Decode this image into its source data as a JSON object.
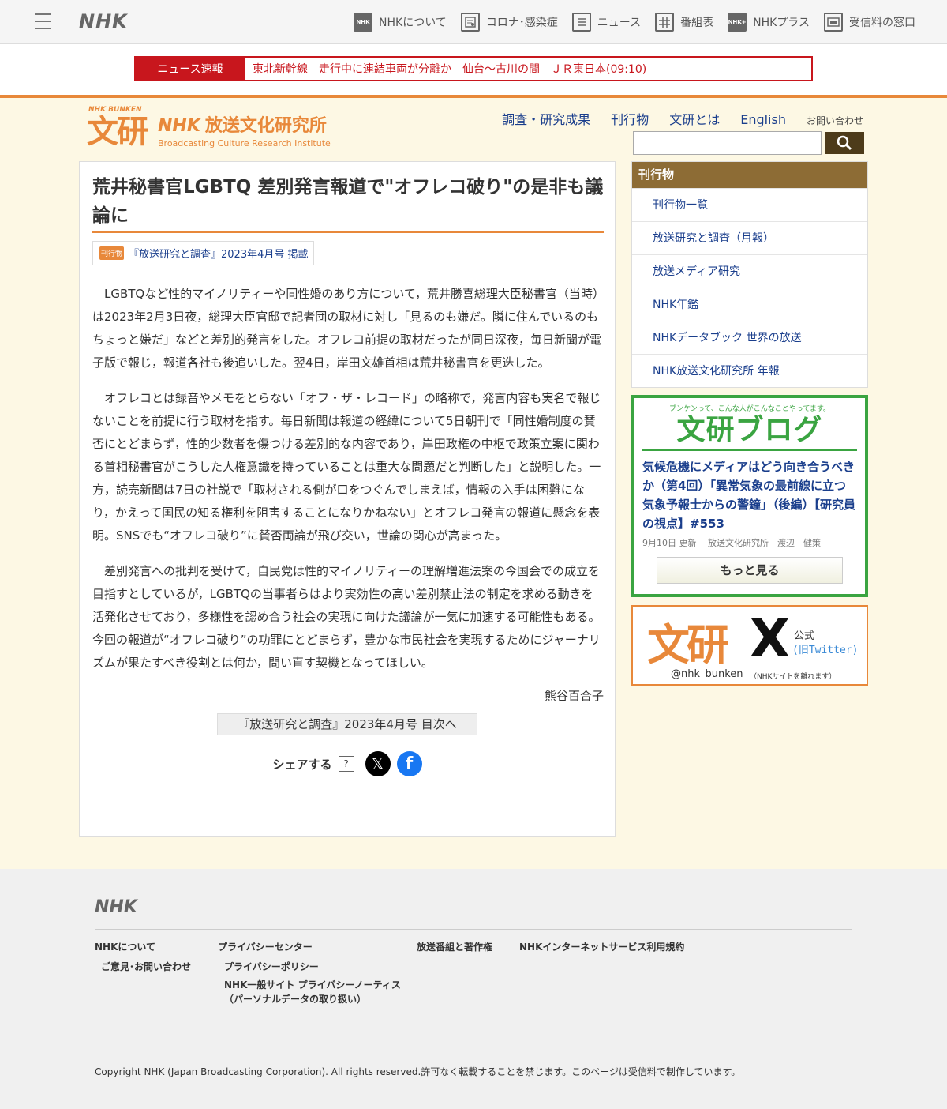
{
  "global_header": {
    "logo": "NHK",
    "nav": [
      {
        "icon": "nhk-icon",
        "icon_text": "NHK",
        "label": "NHKについて"
      },
      {
        "icon": "corona-icon",
        "icon_text": "",
        "label": "コロナ･感染症"
      },
      {
        "icon": "news-icon",
        "icon_text": "",
        "label": "ニュース"
      },
      {
        "icon": "program-guide-icon",
        "icon_text": "",
        "label": "番組表"
      },
      {
        "icon": "nhk-plus-icon",
        "icon_text": "NHK+",
        "label": "NHKプラス"
      },
      {
        "icon": "reception-fee-icon",
        "icon_text": "",
        "label": "受信料の窓口"
      }
    ]
  },
  "breaking_news": {
    "label": "ニュース速報",
    "text": "東北新幹線　走行中に連結車両が分離か　仙台～古川の間　ＪＲ東日本(09:10)"
  },
  "site_header": {
    "logo_small": "NHK BUNKEN",
    "logo_big": "文研",
    "institute_nhk": "NHK",
    "institute_jp": "放送文化研究所",
    "institute_en": "Broadcasting Culture Research Institute",
    "nav": [
      "調査・研究成果",
      "刊行物",
      "文研とは",
      "English",
      "お問い合わせ"
    ],
    "search_placeholder": ""
  },
  "article": {
    "title": "荒井秘書官LGBTQ 差別発言報道で\"オフレコ破り\"の是非も議論に",
    "pub_badge": "刊行物",
    "pub_text": "『放送研究と調査』2023年4月号 掲載",
    "paragraphs": [
      "LGBTQなど性的マイノリティーや同性婚のあり方について，荒井勝喜総理大臣秘書官（当時）は2023年2月3日夜，総理大臣官邸で記者団の取材に対し「見るのも嫌だ。隣に住んでいるのもちょっと嫌だ」などと差別的発言をした。オフレコ前提の取材だったが同日深夜，毎日新聞が電子版で報じ，報道各社も後追いした。翌4日，岸田文雄首相は荒井秘書官を更迭した。",
      "オフレコとは録音やメモをとらない「オフ・ザ・レコード」の略称で，発言内容も実名で報じないことを前提に行う取材を指す。毎日新聞は報道の経緯について5日朝刊で「同性婚制度の賛否にとどまらず，性的少数者を傷つける差別的な内容であり，岸田政権の中枢で政策立案に関わる首相秘書官がこうした人権意識を持っていることは重大な問題だと判断した」と説明した。一方，読売新聞は7日の社説で「取材される側が口をつぐんでしまえば，情報の入手は困難になり，かえって国民の知る権利を阻害することになりかねない」とオフレコ発言の報道に懸念を表明。SNSでも“オフレコ破り”に賛否両論が飛び交い，世論の関心が高まった。",
      "差別発言への批判を受けて，自民党は性的マイノリティーの理解増進法案の今国会での成立を目指すとしているが，LGBTQの当事者らはより実効性の高い差別禁止法の制定を求める動きを活発化させており，多様性を認め合う社会の実現に向けた議論が一気に加速する可能性もある。今回の報道が“オフレコ破り”の功罪にとどまらず，豊かな市民社会を実現するためにジャーナリズムが果たすべき役割とは何か，問い直す契機となってほしい。"
    ],
    "author": "熊谷百合子",
    "toc_button": "『放送研究と調査』2023年4月号 目次へ",
    "share_label": "シェアする",
    "share_help": "?",
    "share_x": "𝕏",
    "share_fb": "f"
  },
  "sidebar": {
    "menu_title": "刊行物",
    "menu_items": [
      "刊行物一覧",
      "放送研究と調査（月報）",
      "放送メディア研究",
      "NHK年鑑",
      "NHKデータブック 世界の放送",
      "NHK放送文化研究所 年報"
    ],
    "blog": {
      "tagline": "ブンケンって、こんな人がこんなことやってます。",
      "title_a": "文研",
      "title_b": "ブログ",
      "post_title": "気候危機にメディアはどう向き合うべきか（第4回）「異常気象の最前線に立つ気象予報士からの警鐘」（後編）【研究員の視点】#553",
      "meta": "9月10日 更新　 放送文化研究所　渡辺　健策",
      "more_button": "もっと見る"
    },
    "x_box": {
      "bunken": "文研",
      "x_logo": "X",
      "official": "公式",
      "old_name": "(旧Twitter)",
      "handle": "@nhk_bunken",
      "note": "（NHKサイトを離れます）"
    }
  },
  "footer": {
    "logo": "NHK",
    "links": [
      {
        "name": "footer-link-about-nhk",
        "label": "NHKについて"
      },
      {
        "name": "footer-link-feedback",
        "label": "ご意見･お問い合わせ"
      },
      {
        "name": "footer-link-privacy-center",
        "label": "プライバシーセンター"
      },
      {
        "name": "footer-link-privacy-policy",
        "label": "プライバシーポリシー"
      },
      {
        "name": "footer-link-privacy-notice",
        "label": "NHK一般サイト プライバシーノーティス"
      },
      {
        "name": "footer-link-personal-data",
        "label": "（パーソナルデータの取り扱い）"
      },
      {
        "name": "footer-link-copyright",
        "label": "放送番組と著作権"
      },
      {
        "name": "footer-link-internet-terms",
        "label": "NHKインターネットサービス利用規約"
      }
    ],
    "copyright": "Copyright NHK (Japan Broadcasting Corporation). All rights reserved.許可なく転載することを禁じます。このページは受信料で制作しています。"
  },
  "colors": {
    "accent_orange": "#e8883a",
    "breaking_red": "#c8161d",
    "link_blue": "#1a3e8c",
    "sidebar_brown": "#8d6c35",
    "blog_green": "#3aa441",
    "site_bg": "#fdf8e4"
  }
}
